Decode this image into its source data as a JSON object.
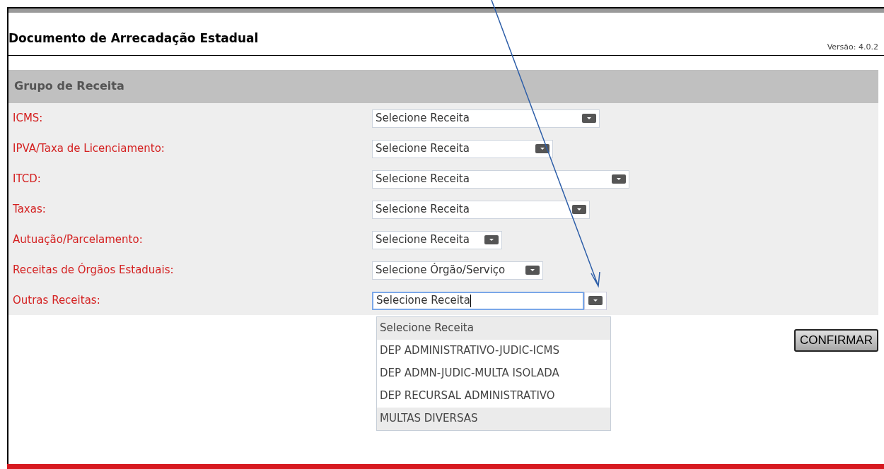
{
  "header": {
    "title": "Documento de Arrecadação Estadual",
    "version": "Versão: 4.0.2"
  },
  "section": {
    "title": "Grupo de Receita"
  },
  "fields": [
    {
      "label": "ICMS:",
      "value": "Selecione Receita",
      "focused": false
    },
    {
      "label": "IPVA/Taxa de Licenciamento:",
      "value": "Selecione Receita",
      "focused": false
    },
    {
      "label": "ITCD:",
      "value": "Selecione Receita",
      "focused": false
    },
    {
      "label": "Taxas:",
      "value": "Selecione Receita",
      "focused": false
    },
    {
      "label": "Autuação/Parcelamento:",
      "value": "Selecione Receita",
      "focused": false
    },
    {
      "label": "Receitas de Órgãos Estaduais:",
      "value": "Selecione Órgão/Serviço",
      "focused": false
    },
    {
      "label": "Outras Receitas:",
      "value": "Selecione Receita",
      "focused": true
    }
  ],
  "dropdown": {
    "expanded": true,
    "options": [
      {
        "label": "Selecione Receita",
        "highlighted": true
      },
      {
        "label": "DEP ADMINISTRATIVO-JUDIC-ICMS",
        "highlighted": false
      },
      {
        "label": "DEP ADMN-JUDIC-MULTA ISOLADA",
        "highlighted": false
      },
      {
        "label": "DEP RECURSAL ADMINISTRATIVO",
        "highlighted": false
      },
      {
        "label": "MULTAS DIVERSAS",
        "highlighted": true
      }
    ]
  },
  "confirm_button": "CONFIRMAR"
}
